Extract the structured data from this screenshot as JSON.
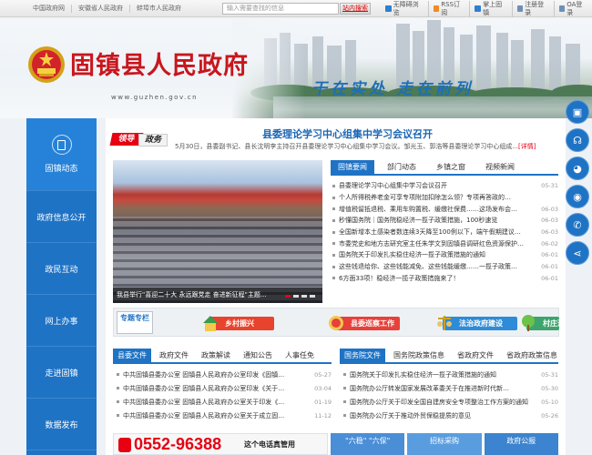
{
  "topbar": {
    "links": [
      "中国政府网",
      "安徽省人民政府",
      "蚌埠市人民政府"
    ],
    "search_placeholder": "输入需要查找的信息",
    "search_button": "站内搜索",
    "right_items": [
      "无障碍浏览",
      "RSS订阅",
      "掌上固镇",
      "注册登录",
      "OA登录"
    ]
  },
  "header": {
    "title": "固镇县人民政府",
    "url": "www.guzhen.gov.cn",
    "slogan": "干在实处 走在前列"
  },
  "nav": {
    "items": [
      "固镇动态",
      "政府信息公开",
      "政民互动",
      "网上办事",
      "走进固镇",
      "数据发布"
    ]
  },
  "leaders": {
    "badge_left": "领导",
    "badge_right": "政务",
    "headline": "县委理论学习中心组集中学习会议召开",
    "summary": "5月30日，县委副书记、县长沈明李主持召开县委理论学习中心组集中学习会议。邹光玉、郭浩等县委理论学习中心组成...",
    "more": "[详情]"
  },
  "slider": {
    "caption": "我县举行\"喜迎二十大 永远跟党走 奋进新征程\"主题...",
    "dots": 4,
    "active": 0
  },
  "news": {
    "tabs": [
      "固镇要闻",
      "部门动态",
      "乡镇之窗",
      "视频新闻"
    ],
    "active": 0,
    "items": [
      {
        "title": "县委理论学习中心组集中学习会议召开",
        "date": "05-31"
      },
      {
        "title": "个人所得税养老金可享专项附加扣除怎么领？专项再答政的…",
        "date": ""
      },
      {
        "title": "增值税留抵退税、乘用车购置税、缓缴社保费……这场发布会…",
        "date": "06-03"
      },
      {
        "title": "秒懂国务院｜国务院稳经济一揽子政策措施，100秒速览",
        "date": "06-03"
      },
      {
        "title": "全国新增本土感染者数连续3天降至100例以下，端午假期建议…",
        "date": "06-03"
      },
      {
        "title": "市委党史和地方志研究室主任朱学文到固镇县调研红色资源保护…",
        "date": "06-02"
      },
      {
        "title": "国务院关于印发扎实稳住经济一揽子政策措施的通知",
        "date": "06-01"
      },
      {
        "title": "这些钱退给你、这些钱能减免、这些钱能缓缴……一揽子政策…",
        "date": "06-01"
      },
      {
        "title": "6方面33项！稳经济一揽子政策措施来了！",
        "date": "06-01"
      }
    ]
  },
  "special": {
    "badge": "专题专栏",
    "items": [
      {
        "label": "乡村振兴",
        "color": "#e8432c"
      },
      {
        "label": "县委巡察工作",
        "color": "#e7413a"
      },
      {
        "label": "法治政府建设",
        "color": "#2e8bd7"
      },
      {
        "label": "村庄清洁",
        "color": "#3da46d"
      }
    ]
  },
  "county_docs": {
    "tabs": [
      "县委文件",
      "政府文件",
      "政策解读",
      "通知公告",
      "人事任免"
    ],
    "active": 0,
    "items": [
      {
        "title": "中共固镇县委办公室 固镇县人民政府办公室印发《固镇…",
        "date": "05-27"
      },
      {
        "title": "中共固镇县委办公室 固镇县人民政府办公室印发《关于…",
        "date": "03-04"
      },
      {
        "title": "中共固镇县委办公室 固镇县人民政府办公室关于印发《…",
        "date": "01-19"
      },
      {
        "title": "中共固镇县委办公室 固镇县人民政府办公室关于成立固…",
        "date": "11-12"
      }
    ]
  },
  "state_docs": {
    "tabs": [
      "国务院文件",
      "国务院政策信息",
      "省政府文件",
      "省政府政策信息"
    ],
    "active": 0,
    "items": [
      {
        "title": "国务院关于印发扎实稳住经济一揽子政策措施的通知",
        "date": "05-31"
      },
      {
        "title": "国务院办公厅转发国家发展改革委关于在推进新时代新…",
        "date": "05-30"
      },
      {
        "title": "国务院办公厅关于印发全国自建房安全专项整治工作方案的通知",
        "date": "05-10"
      },
      {
        "title": "国务院办公厅关于推动外贸保稳提质的意见",
        "date": "05-26"
      }
    ]
  },
  "hotline": {
    "number": "0552-96388",
    "tag": "这个电话真管用"
  },
  "bottom_blocks": [
    {
      "label": "\"六稳\" \"六保\"",
      "color": "#4a8ed6"
    },
    {
      "label": "招标采购",
      "color": "#5a9ddf"
    },
    {
      "label": "政府公报",
      "color": "#3c84cf"
    }
  ],
  "float_icons": [
    "screen-icon",
    "headset-icon",
    "wechat-icon",
    "weibo-icon",
    "phone-icon",
    "share-icon"
  ],
  "colors": {
    "brand_red": "#c8161d",
    "brand_blue": "#1f73c5"
  }
}
